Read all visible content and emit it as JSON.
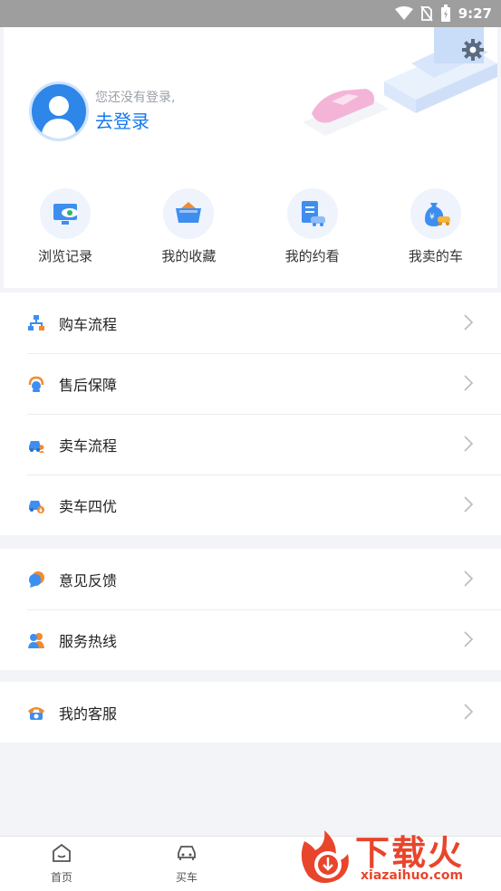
{
  "status_bar": {
    "time": "9:27"
  },
  "profile": {
    "hint": "您还没有登录,",
    "login_label": "去登录"
  },
  "quick_actions": [
    {
      "label": "浏览记录",
      "icon": "monitor-eye-icon"
    },
    {
      "label": "我的收藏",
      "icon": "folder-star-icon"
    },
    {
      "label": "我的约看",
      "icon": "document-car-icon"
    },
    {
      "label": "我卖的车",
      "icon": "moneybag-car-icon"
    }
  ],
  "menu_group_1": [
    {
      "label": "购车流程",
      "icon": "flowchart-icon"
    },
    {
      "label": "售后保障",
      "icon": "headset-icon"
    },
    {
      "label": "卖车流程",
      "icon": "car-person-icon"
    },
    {
      "label": "卖车四优",
      "icon": "car-badge-icon"
    }
  ],
  "menu_group_2": [
    {
      "label": "意见反馈",
      "icon": "chat-bubble-icon"
    },
    {
      "label": "服务热线",
      "icon": "users-icon"
    }
  ],
  "menu_group_3": [
    {
      "label": "我的客服",
      "icon": "phone-icon"
    }
  ],
  "bottom_nav": [
    {
      "label": "首页",
      "icon": "home-icon"
    },
    {
      "label": "买车",
      "icon": "car-icon"
    }
  ],
  "watermark": {
    "title": "下载火",
    "subtitle": "xiazaihuo.com"
  },
  "colors": {
    "accent": "#1479f0",
    "orange": "#f28a2e",
    "watermark": "#e8452c"
  }
}
